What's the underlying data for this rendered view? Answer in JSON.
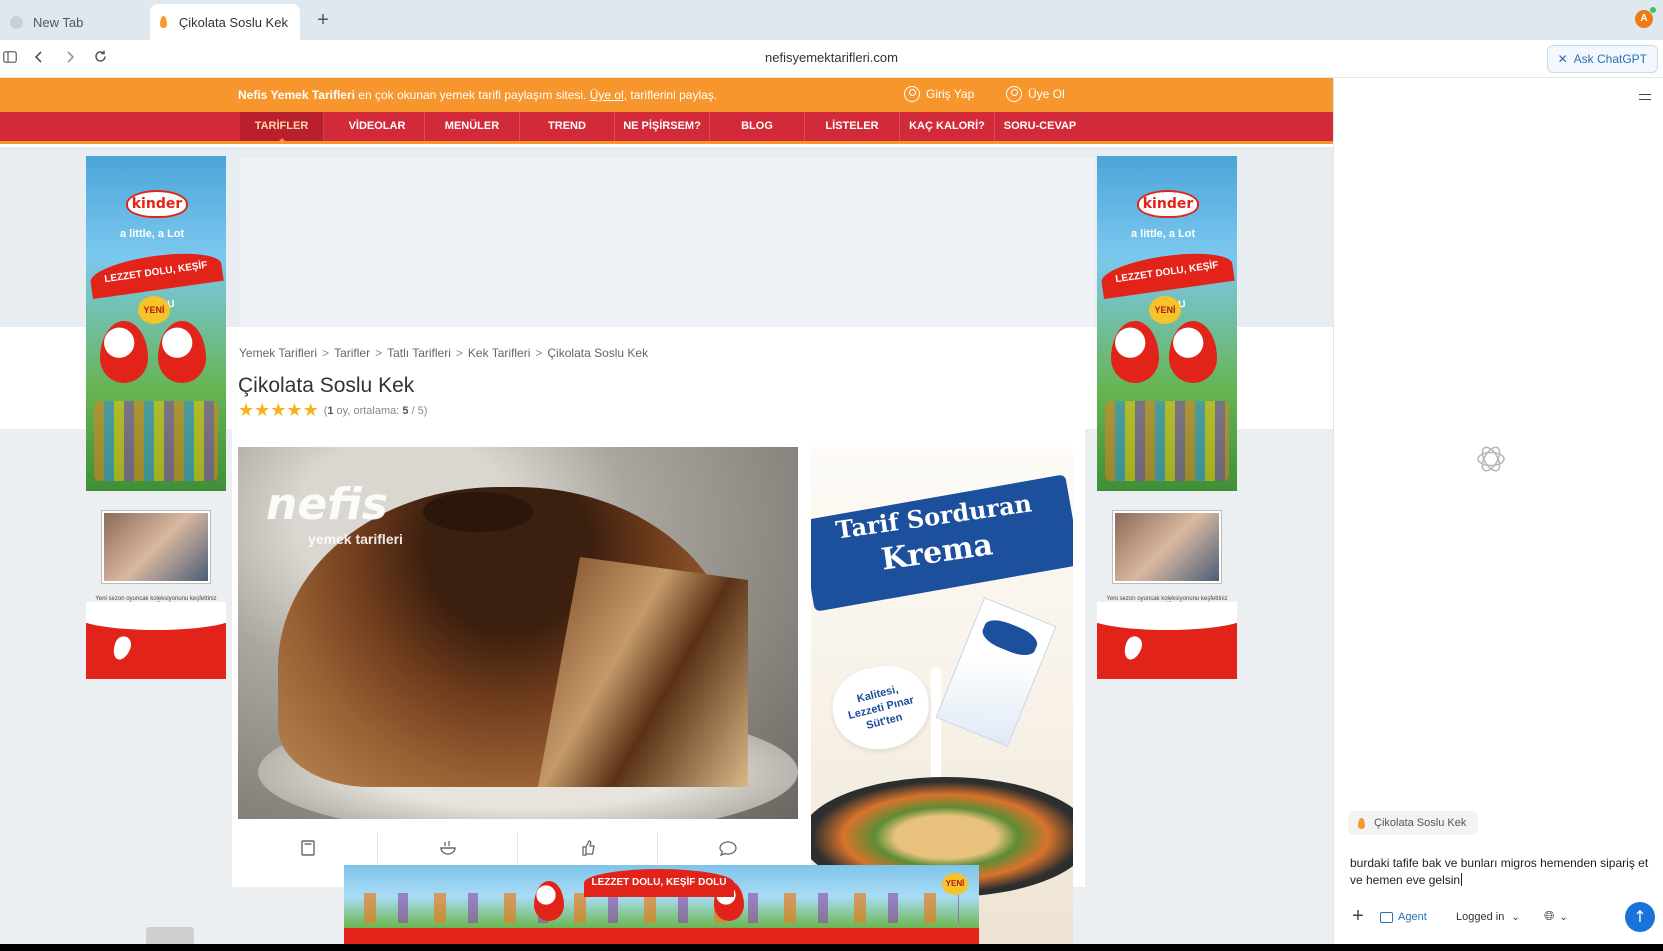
{
  "browser": {
    "tabs": [
      {
        "title": "New Tab",
        "active": false
      },
      {
        "title": "Çikolata Soslu Kek - N",
        "active": true
      }
    ],
    "url": "nefisyemektarifleri.com",
    "ask_chatgpt_label": "Ask ChatGPT",
    "profile_initial": "A"
  },
  "site": {
    "topbar": {
      "brand": "Nefis Yemek Tarifleri",
      "message": " en çok okunan yemek tarifi paylaşım sitesi. ",
      "signup_link": "Üye ol,",
      "message_end": " tariflerini paylaş.",
      "login": "Giriş Yap",
      "register": "Üye Ol"
    },
    "nav": [
      "TARİFLER",
      "VİDEOLAR",
      "MENÜLER",
      "TREND",
      "NE PİŞİRSEM?",
      "BLOG",
      "LİSTELER",
      "KAÇ KALORİ?",
      "SORU-CEVAP"
    ],
    "breadcrumb": [
      "Yemek Tarifleri",
      "Tarifler",
      "Tatlı Tarifleri",
      "Kek Tarifleri",
      "Çikolata Soslu Kek"
    ],
    "recipe": {
      "title": "Çikolata Soslu Kek",
      "stars": 5,
      "votes": "1",
      "votes_text": " oy, ortalama: ",
      "average": "5",
      "average_max": " / 5)"
    },
    "hero_logo": "nefis",
    "hero_logo_sub": "yemek tarifleri",
    "ads": {
      "kinder_logo": "kinder",
      "kinder_tagline": "a little, a Lot",
      "kinder_arc": "LEZZET DOLU, KEŞİF DOLU",
      "kinder_new": "YENİ",
      "kinder_photo_caption": "Yeni sezon oyuncak koleksiyonunu keşfettiniz mi?",
      "krema_line1": "Tarif Sorduran",
      "krema_line2": "Krema",
      "krema_heart": "Kalitesi, Lezzeti Pınar Süt'ten"
    }
  },
  "chatgpt_panel": {
    "context_chip": "Çikolata Soslu Kek",
    "prompt_text": "burdaki tafife bak ve bunları migros hemenden sipariş et ve hemen eve gelsin",
    "agent_label": "Agent",
    "login_state": "Logged in"
  }
}
